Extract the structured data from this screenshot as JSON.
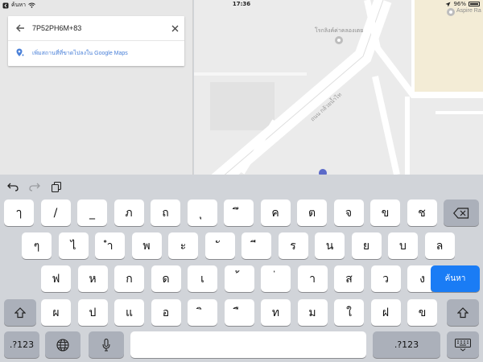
{
  "status_bar": {
    "carrier": "ค้นหา",
    "time": "17:36",
    "battery": "96%",
    "battery_level": 0.96
  },
  "search_panel": {
    "query": "7P52PH6M+83",
    "add_place_label": "เพิ่มสถานที่ที่ขาดไปลงใน Google Maps"
  },
  "map": {
    "poi_1": "โรกลิงค์ค่าคลองเตย",
    "poi_2": "Aspire Ra",
    "road_label": "ถนน กล้วยน้ำไท"
  },
  "keyboard": {
    "row1": [
      "ๅ",
      "/",
      "_",
      "ภ",
      "ถ",
      "ุ",
      "ึ",
      "ค",
      "ต",
      "จ",
      "ข",
      "ช"
    ],
    "row2": [
      "ๆ",
      "ไ",
      "ำ",
      "พ",
      "ะ",
      "ั",
      "ี",
      "ร",
      "น",
      "ย",
      "บ",
      "ล"
    ],
    "row3": [
      "ฟ",
      "ห",
      "ก",
      "ด",
      "เ",
      "้",
      "่",
      "า",
      "ส",
      "ว",
      "ง"
    ],
    "row4": [
      "ผ",
      "ป",
      "แ",
      "อ",
      "ิ",
      "ื",
      "ท",
      "ม",
      "ใ",
      "ฝ",
      "ข"
    ],
    "search_key": "ค้นหา",
    "numbers_key": ".?123"
  },
  "colors": {
    "accent_blue": "#1a7cf5",
    "link_blue": "#4a80d8"
  }
}
